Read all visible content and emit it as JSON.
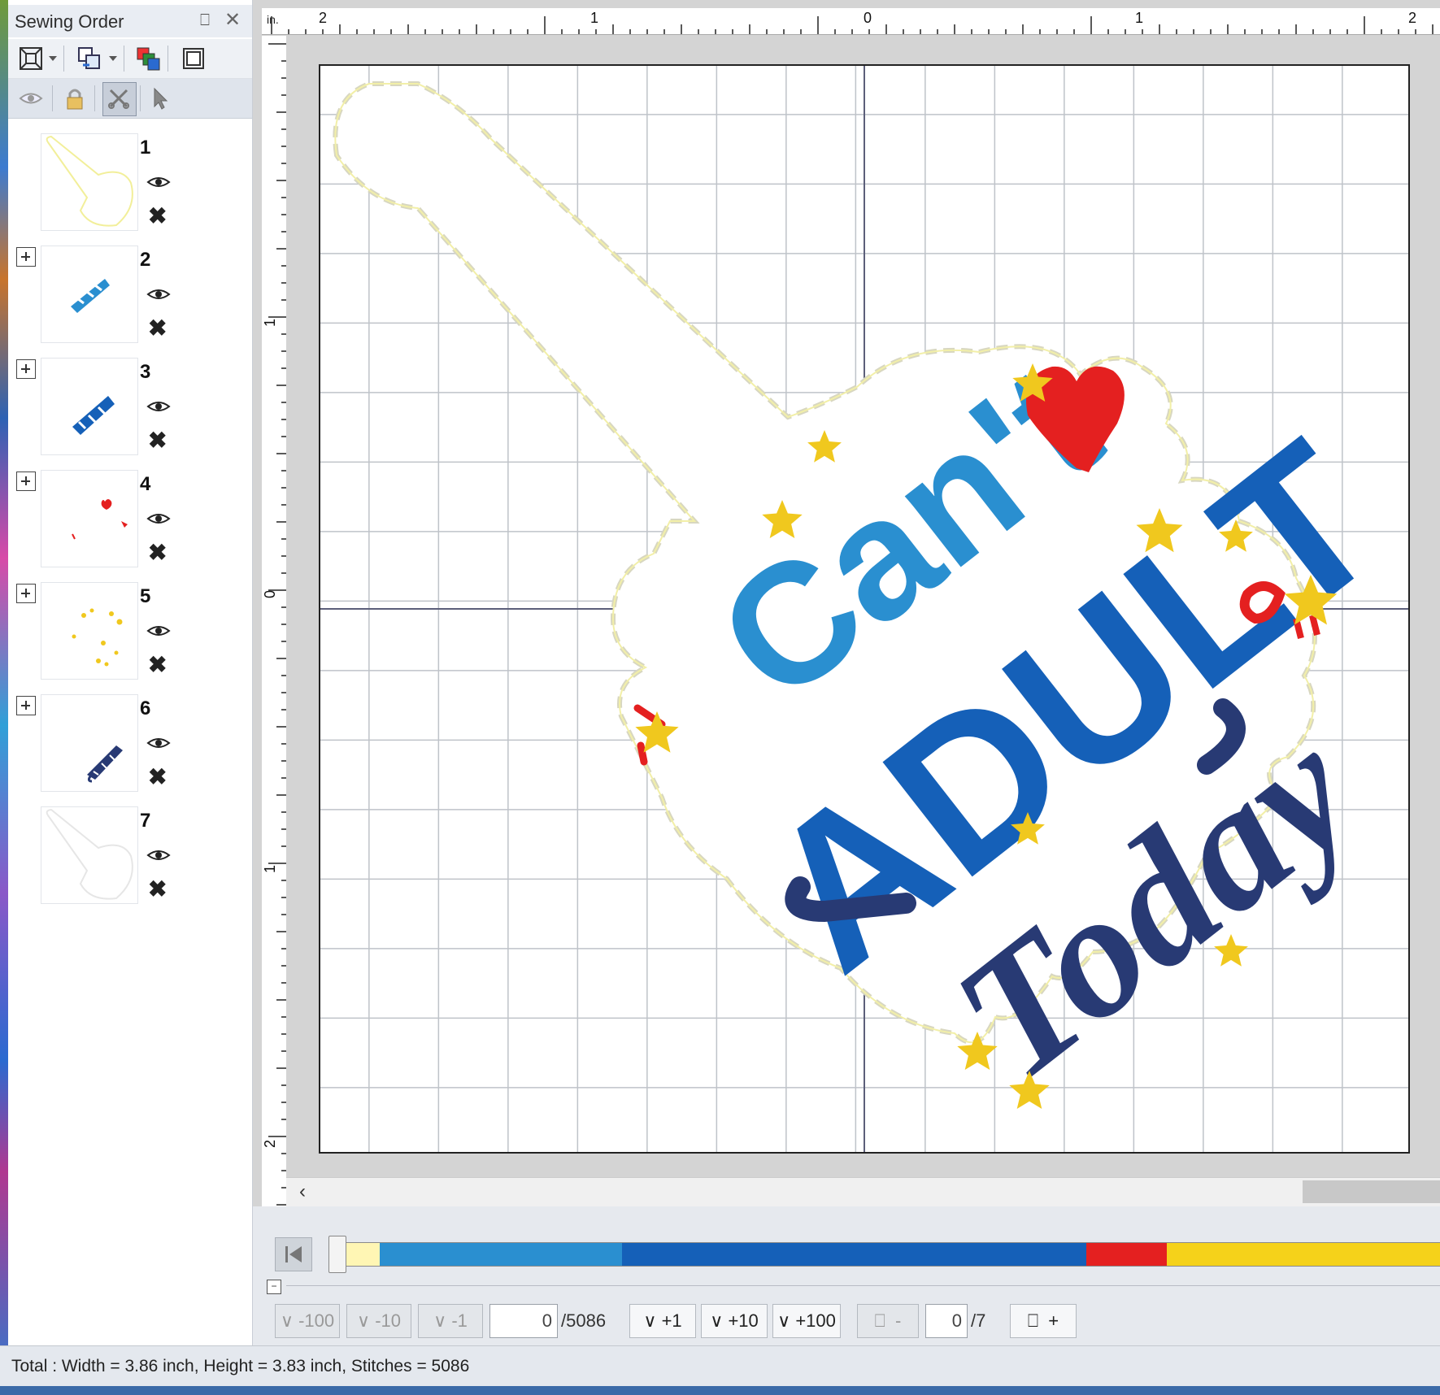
{
  "panel": {
    "title": "Sewing Order",
    "items": [
      {
        "num": "1",
        "expander": false
      },
      {
        "num": "2",
        "expander": true
      },
      {
        "num": "3",
        "expander": true
      },
      {
        "num": "4",
        "expander": true
      },
      {
        "num": "5",
        "expander": true
      },
      {
        "num": "6",
        "expander": true
      },
      {
        "num": "7",
        "expander": false
      }
    ]
  },
  "ruler": {
    "unit": "in.",
    "top_labels": [
      "2",
      "1",
      "0",
      "1",
      "2"
    ],
    "left_labels": [
      "1",
      "0",
      "1",
      "2"
    ]
  },
  "design": {
    "text_line1": "Can't",
    "text_line2": "ADULT",
    "text_line3": "Today",
    "colors": {
      "outline": "#fff6b0",
      "cant": "#2a8fd0",
      "adult": "#1560b8",
      "today": "#283a74",
      "heart": "#e42020",
      "stars": "#f0c81e"
    }
  },
  "navigation": {
    "minus100": "-100",
    "minus10": "-10",
    "minus1": "-1",
    "stitch_value": "0",
    "stitch_total": "/5086",
    "plus1": "+1",
    "plus10": "+10",
    "plus100": "+100",
    "color_minus": "-",
    "color_value": "0",
    "color_total": "/7",
    "color_plus": "+"
  },
  "sequence_colors": [
    {
      "color": "#fff6b4",
      "fraction": 0.045
    },
    {
      "color": "#2a8fd0",
      "fraction": 0.218
    },
    {
      "color": "#1560b8",
      "fraction": 0.418
    },
    {
      "color": "#e42020",
      "fraction": 0.072
    },
    {
      "color": "#f5d21a",
      "fraction": 0.247
    }
  ],
  "status": {
    "text": "Total : Width = 3.86 inch, Height = 3.83 inch, Stitches = 5086"
  }
}
